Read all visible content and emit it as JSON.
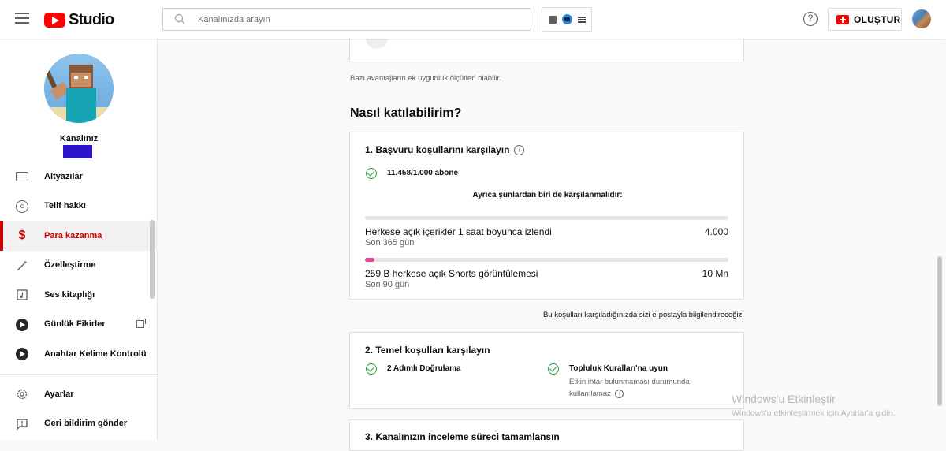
{
  "header": {
    "logo_text": "Studio",
    "search_placeholder": "Kanalınızda arayın",
    "help_symbol": "?",
    "create_label": "OLUŞTUR"
  },
  "sidebar": {
    "channel_label": "Kanalınız",
    "items": [
      {
        "label": "Altyazılar",
        "icon": "subtitles-icon"
      },
      {
        "label": "Telif hakkı",
        "icon": "copyright-icon",
        "symbol": "c"
      },
      {
        "label": "Para kazanma",
        "icon": "dollar-icon",
        "symbol": "$",
        "active": true
      },
      {
        "label": "Özelleştirme",
        "icon": "magic-wand-icon"
      },
      {
        "label": "Ses kitaplığı",
        "icon": "music-library-icon"
      },
      {
        "label": "Günlük Fikirler",
        "icon": "extension-play-icon",
        "external": true
      },
      {
        "label": "Anahtar Kelime Kontrolü",
        "icon": "extension-play-icon"
      }
    ],
    "bottom_items": [
      {
        "label": "Ayarlar",
        "icon": "gear-icon"
      },
      {
        "label": "Geri bildirim gönder",
        "icon": "feedback-icon"
      }
    ]
  },
  "main": {
    "note_top": "Bazı avantajların ek uygunluk ölçütleri olabilir.",
    "heading": "Nasıl katılabilirim?",
    "step1": {
      "title": "1. Başvuru koşullarını karşılayın",
      "info_symbol": "i",
      "subscribers": "11.458/1.000 abone",
      "also_text": "Ayrıca şunlardan biri de karşılanmalıdır:",
      "metrics": [
        {
          "label": "Herkese açık içerikler 1 saat boyunca izlendi",
          "sub": "Son 365 gün",
          "value": "4.000",
          "progress": 0.0
        },
        {
          "label": "259 B herkese açık Shorts görüntülemesi",
          "sub": "Son 90 gün",
          "value": "10 Mn",
          "progress": 0.0259
        }
      ]
    },
    "email_note": "Bu koşulları karşıladığınızda sizi e-postayla bilgilendireceğiz.",
    "step2": {
      "title": "2. Temel koşulları karşılayın",
      "req1": "2 Adımlı Doğrulama",
      "req2": "Topluluk Kuralları'na uyun",
      "req2_sub": "Etkin ihtar bulunmaması durumunda kullanılamaz"
    },
    "step3": {
      "title": "3. Kanalınızın inceleme süreci tamamlansın"
    }
  },
  "watermark": {
    "title": "Windows'u Etkinleştir",
    "subtitle": "Windows'u etkinleştirmek için Ayarlar'a gidin."
  },
  "colors": {
    "accent_red": "#cc0000",
    "check_green": "#2ba640",
    "progress_pink": "#e6469a",
    "channel_box": "#2b14c9"
  }
}
